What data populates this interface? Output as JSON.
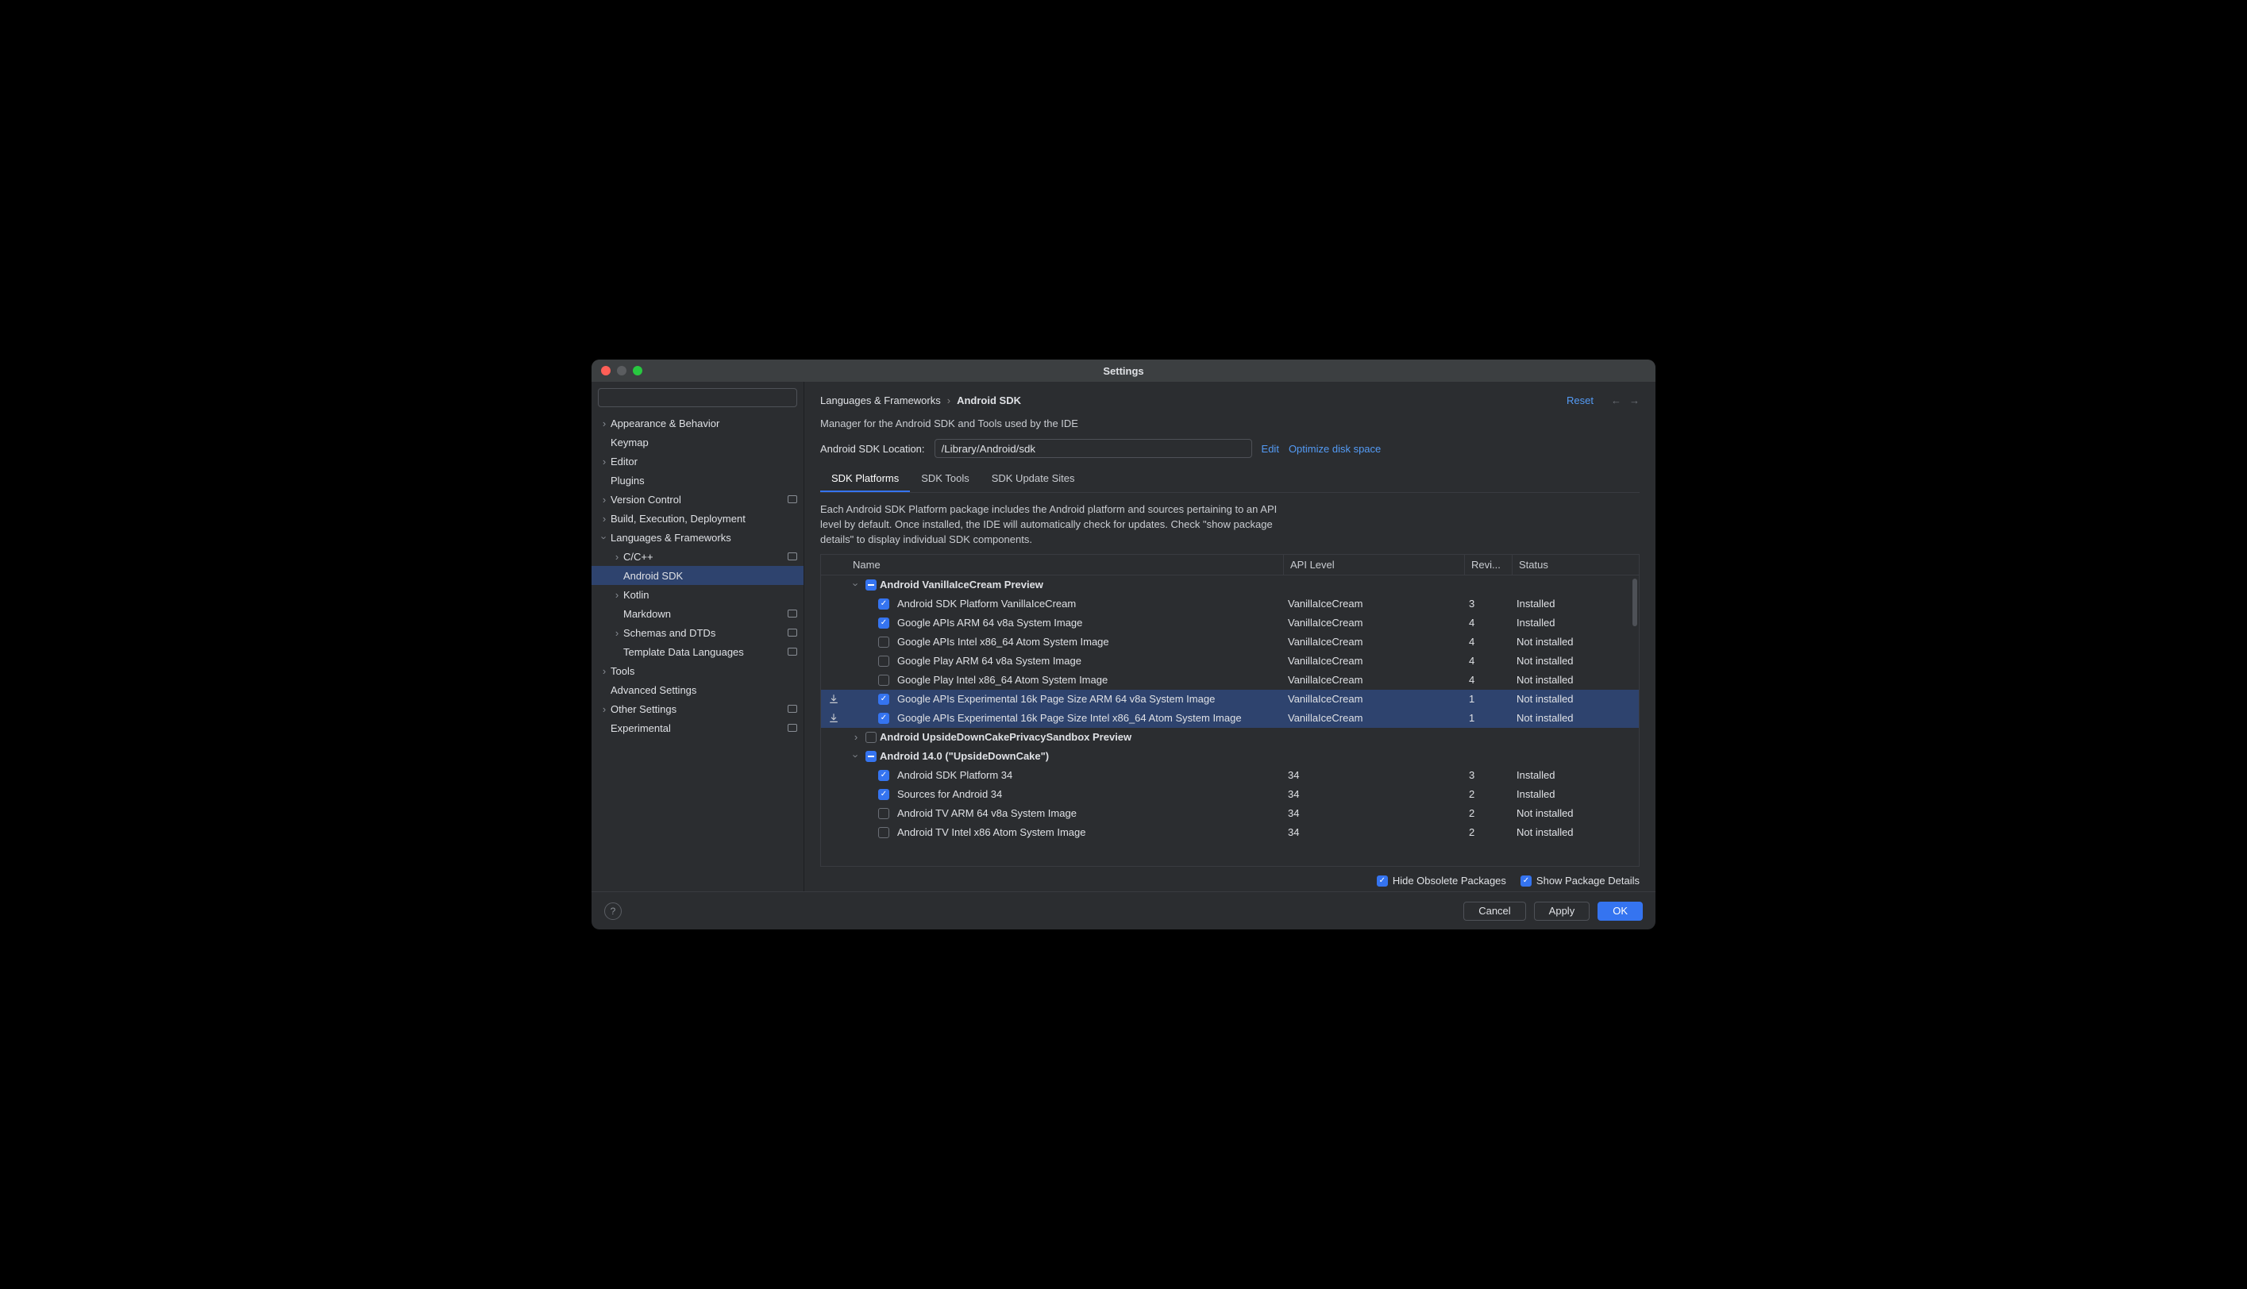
{
  "window": {
    "title": "Settings"
  },
  "header": {
    "crumb_parent": "Languages & Frameworks",
    "crumb_sep": "›",
    "crumb_current": "Android SDK",
    "reset": "Reset"
  },
  "search": {
    "placeholder": ""
  },
  "sidebar": {
    "items": [
      {
        "label": "Appearance & Behavior",
        "depth": 0,
        "chev": "right"
      },
      {
        "label": "Keymap",
        "depth": 0
      },
      {
        "label": "Editor",
        "depth": 0,
        "chev": "right"
      },
      {
        "label": "Plugins",
        "depth": 0
      },
      {
        "label": "Version Control",
        "depth": 0,
        "chev": "right",
        "badge": true
      },
      {
        "label": "Build, Execution, Deployment",
        "depth": 0,
        "chev": "right"
      },
      {
        "label": "Languages & Frameworks",
        "depth": 0,
        "chev": "down"
      },
      {
        "label": "C/C++",
        "depth": 1,
        "chev": "right",
        "badge": true
      },
      {
        "label": "Android SDK",
        "depth": 1,
        "selected": true
      },
      {
        "label": "Kotlin",
        "depth": 1,
        "chev": "right"
      },
      {
        "label": "Markdown",
        "depth": 1,
        "badge": true
      },
      {
        "label": "Schemas and DTDs",
        "depth": 1,
        "chev": "right",
        "badge": true
      },
      {
        "label": "Template Data Languages",
        "depth": 1,
        "badge": true
      },
      {
        "label": "Tools",
        "depth": 0,
        "chev": "right"
      },
      {
        "label": "Advanced Settings",
        "depth": 0
      },
      {
        "label": "Other Settings",
        "depth": 0,
        "chev": "right",
        "badge": true
      },
      {
        "label": "Experimental",
        "depth": 0,
        "badge": true
      }
    ]
  },
  "manager": {
    "subtitle": "Manager for the Android SDK and Tools used by the IDE",
    "location_label": "Android SDK Location:",
    "location_value": "/Library/Android/sdk",
    "edit": "Edit",
    "optimize": "Optimize disk space"
  },
  "tabs": [
    {
      "label": "SDK Platforms",
      "active": true
    },
    {
      "label": "SDK Tools"
    },
    {
      "label": "SDK Update Sites"
    }
  ],
  "tab_desc": "Each Android SDK Platform package includes the Android platform and sources pertaining to an API level by default. Once installed, the IDE will automatically check for updates. Check \"show package details\" to display individual SDK components.",
  "columns": {
    "name": "Name",
    "api": "API Level",
    "rev": "Revi...",
    "status": "Status"
  },
  "rows": [
    {
      "type": "group",
      "chev": "down",
      "cb": "mixed",
      "name": "Android VanillaIceCream Preview"
    },
    {
      "type": "item",
      "cb": "checked",
      "name": "Android SDK Platform VanillaIceCream",
      "api": "VanillaIceCream",
      "rev": "3",
      "status": "Installed"
    },
    {
      "type": "item",
      "cb": "checked",
      "name": "Google APIs ARM 64 v8a System Image",
      "api": "VanillaIceCream",
      "rev": "4",
      "status": "Installed"
    },
    {
      "type": "item",
      "cb": "",
      "name": "Google APIs Intel x86_64 Atom System Image",
      "api": "VanillaIceCream",
      "rev": "4",
      "status": "Not installed"
    },
    {
      "type": "item",
      "cb": "",
      "name": "Google Play ARM 64 v8a System Image",
      "api": "VanillaIceCream",
      "rev": "4",
      "status": "Not installed"
    },
    {
      "type": "item",
      "cb": "",
      "name": "Google Play Intel x86_64 Atom System Image",
      "api": "VanillaIceCream",
      "rev": "4",
      "status": "Not installed"
    },
    {
      "type": "item",
      "cb": "checked",
      "dl": true,
      "sel": true,
      "name": "Google APIs Experimental 16k Page Size ARM 64 v8a System Image",
      "api": "VanillaIceCream",
      "rev": "1",
      "status": "Not installed"
    },
    {
      "type": "item",
      "cb": "checked",
      "dl": true,
      "sel": true,
      "name": "Google APIs Experimental 16k Page Size Intel x86_64 Atom System Image",
      "api": "VanillaIceCream",
      "rev": "1",
      "status": "Not installed"
    },
    {
      "type": "group",
      "chev": "right",
      "cb": "",
      "name": "Android UpsideDownCakePrivacySandbox Preview"
    },
    {
      "type": "group",
      "chev": "down",
      "cb": "mixed",
      "name": "Android 14.0 (\"UpsideDownCake\")"
    },
    {
      "type": "item",
      "cb": "checked",
      "name": "Android SDK Platform 34",
      "api": "34",
      "rev": "3",
      "status": "Installed"
    },
    {
      "type": "item",
      "cb": "checked",
      "name": "Sources for Android 34",
      "api": "34",
      "rev": "2",
      "status": "Installed"
    },
    {
      "type": "item",
      "cb": "",
      "name": "Android TV ARM 64 v8a System Image",
      "api": "34",
      "rev": "2",
      "status": "Not installed"
    },
    {
      "type": "item",
      "cb": "",
      "name": "Android TV Intel x86 Atom System Image",
      "api": "34",
      "rev": "2",
      "status": "Not installed"
    }
  ],
  "options": {
    "hide": "Hide Obsolete Packages",
    "details": "Show Package Details"
  },
  "footer": {
    "cancel": "Cancel",
    "apply": "Apply",
    "ok": "OK"
  }
}
